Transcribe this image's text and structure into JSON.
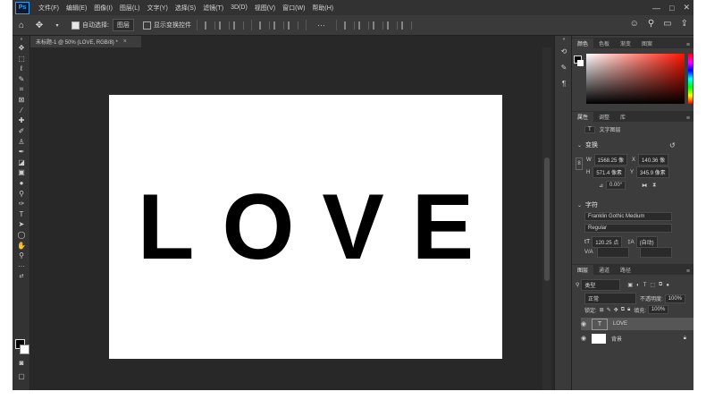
{
  "app": {
    "logo": "Ps"
  },
  "menu": [
    "文件(F)",
    "编辑(E)",
    "图像(I)",
    "图层(L)",
    "文字(Y)",
    "选择(S)",
    "滤镜(T)",
    "3D(D)",
    "视图(V)",
    "窗口(W)",
    "帮助(H)"
  ],
  "options": {
    "auto_select_label": "自动选择:",
    "auto_select_value": "图层",
    "show_transform_label": "显示变换控件",
    "more": "···"
  },
  "document": {
    "tab_label": "未标题-1 @ 50% (LOVE, RGB/8) *",
    "text": "LOVE"
  },
  "color_panel": {
    "tabs": [
      "颜色",
      "色板",
      "渐变",
      "图案"
    ]
  },
  "properties_panel": {
    "tabs": [
      "属性",
      "调整",
      "库"
    ],
    "layer_type": "文字图层",
    "transform_header": "变换",
    "w_label": "W",
    "w_value": "1568.25 像",
    "x_label": "X",
    "x_value": "140.36 像",
    "h_label": "H",
    "h_value": "571.4 像素",
    "y_label": "Y",
    "y_value": "345.9 像素",
    "angle_value": "0.00°",
    "char_header": "字符",
    "font_family": "Franklin Gothic Medium",
    "font_style": "Regular",
    "font_size": "120.25 点",
    "leading": "(自动)",
    "tracking_label": "V/A"
  },
  "layers_panel": {
    "tabs": [
      "图层",
      "通道",
      "路径"
    ],
    "filter_value": "类型",
    "blend_mode": "正常",
    "opacity_label": "不透明度:",
    "opacity_value": "100%",
    "lock_label": "锁定:",
    "fill_label": "填充:",
    "fill_value": "100%",
    "layers": [
      {
        "name": "LOVE",
        "type": "text",
        "thumb": "T"
      },
      {
        "name": "背景",
        "type": "background",
        "thumb": ""
      }
    ]
  }
}
